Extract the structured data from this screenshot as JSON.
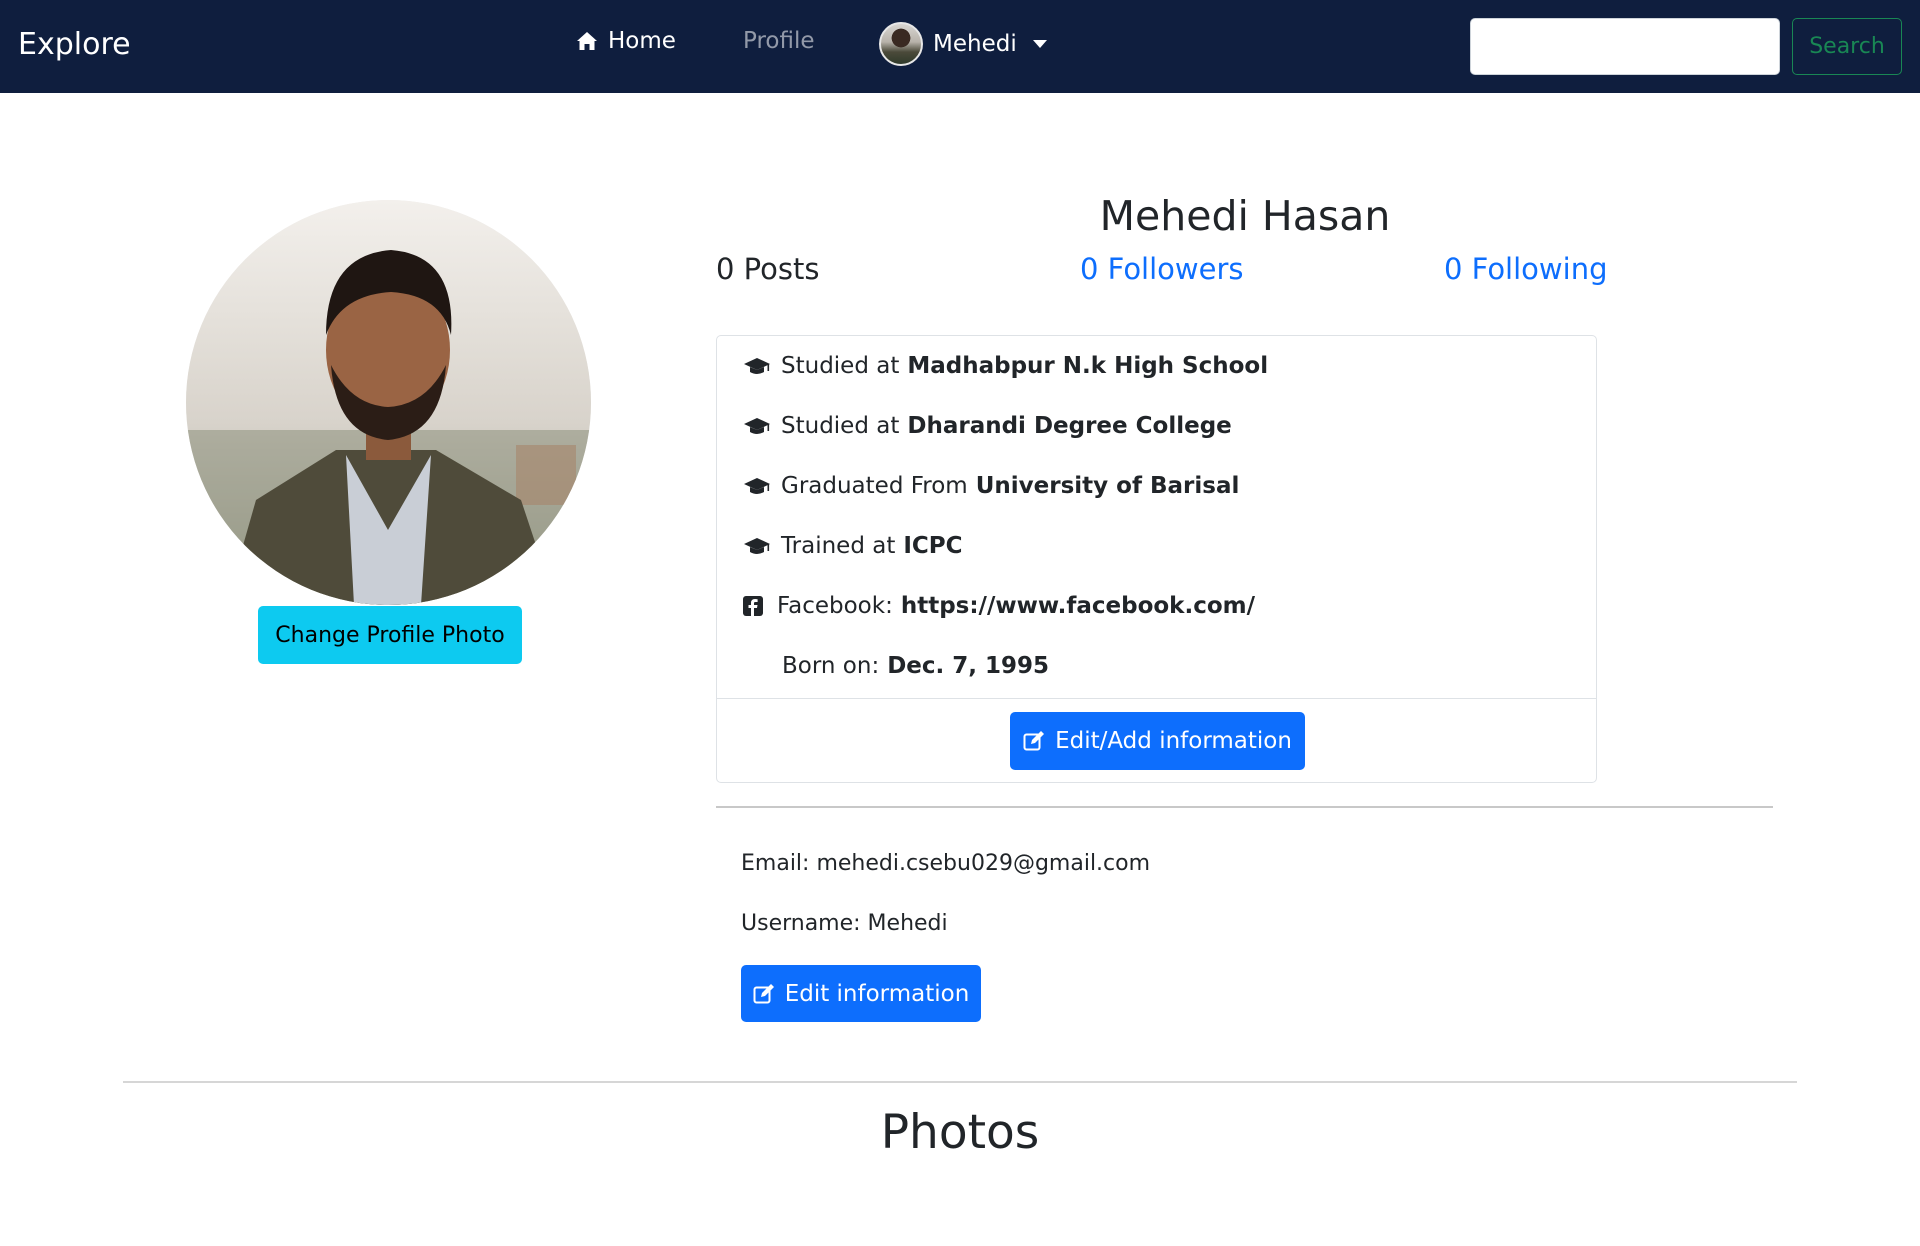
{
  "navbar": {
    "brand": "Explore",
    "home_label": "Home",
    "profile_label": "Profile",
    "user_label": "Mehedi",
    "search_placeholder": "",
    "search_button": "Search",
    "bg_color": "#0f1e3e"
  },
  "profile": {
    "name": "Mehedi Hasan",
    "change_photo_label": "Change Profile Photo",
    "stats": {
      "posts": "0 Posts",
      "followers": "0 Followers",
      "following": "0 Following"
    }
  },
  "info": {
    "rows": [
      {
        "icon": "graduation-cap-icon",
        "prefix": "Studied at",
        "value": "Madhabpur N.k High School"
      },
      {
        "icon": "graduation-cap-icon",
        "prefix": "Studied at",
        "value": "Dharandi Degree College"
      },
      {
        "icon": "graduation-cap-icon",
        "prefix": "Graduated From",
        "value": "University of Barisal"
      },
      {
        "icon": "graduation-cap-icon",
        "prefix": "Trained at",
        "value": "ICPC"
      },
      {
        "icon": "facebook-icon",
        "prefix": "Facebook:",
        "value": "https://www.facebook.com/"
      },
      {
        "icon": "",
        "prefix": "Born on:",
        "value": "Dec. 7, 1995"
      }
    ],
    "edit_add_label": "Edit/Add information"
  },
  "account": {
    "email": "Email: mehedi.csebu029@gmail.com",
    "username": "Username: Mehedi",
    "edit_label": "Edit information"
  },
  "photos": {
    "heading": "Photos"
  },
  "colors": {
    "primary": "#0d6efd",
    "info": "#0dcaf0",
    "success": "#198754"
  }
}
